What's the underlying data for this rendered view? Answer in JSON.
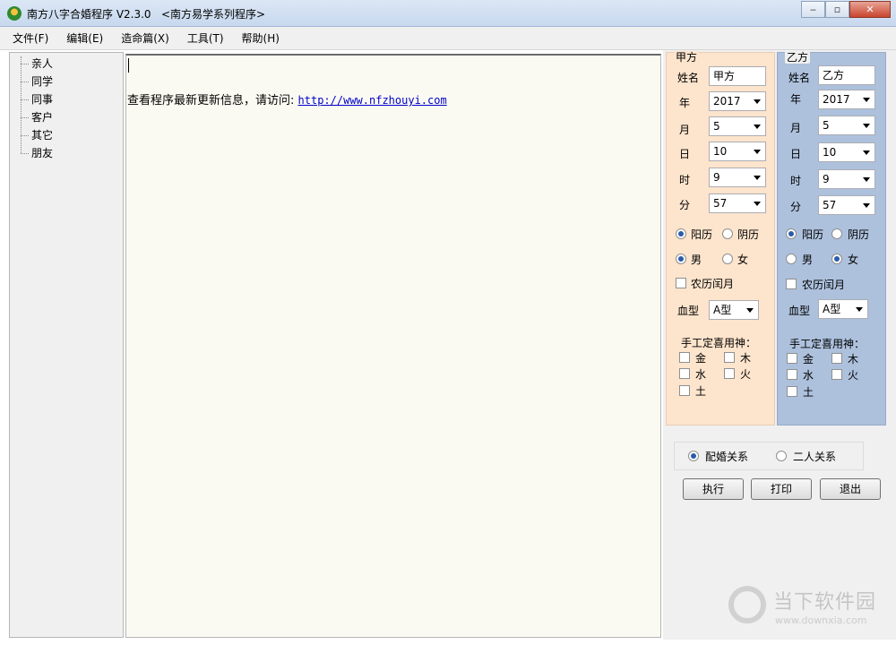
{
  "window": {
    "title": "南方八字合婚程序 V2.3.0   <南方易学系列程序>",
    "minimize": "▭",
    "restore": "□",
    "close": "✕"
  },
  "menu": [
    "文件(F)",
    "编辑(E)",
    "造命篇(X)",
    "工具(T)",
    "帮助(H)"
  ],
  "tree": [
    "亲人",
    "同学",
    "同事",
    "客户",
    "其它",
    "朋友"
  ],
  "content": {
    "info_text": "查看程序最新更新信息，请访问:",
    "link": "http://www.nfzhouyi.com"
  },
  "labels": {
    "name": "姓名",
    "year": "年",
    "month": "月",
    "day": "日",
    "hour": "时",
    "minute": "分",
    "solar": "阳历",
    "lunar": "阴历",
    "male": "男",
    "female": "女",
    "leap": "农历闰月",
    "blood": "血型",
    "manual": "手工定喜用神：",
    "metal": "金",
    "wood": "木",
    "water": "水",
    "fire": "火",
    "earth": "土"
  },
  "party_a": {
    "legend": "甲方",
    "name": "甲方",
    "year": "2017",
    "month": "5",
    "day": "10",
    "hour": "9",
    "minute": "57",
    "calendar": "solar",
    "gender": "male",
    "blood": "A型",
    "color": "#fde4cc"
  },
  "party_b": {
    "legend": "乙方",
    "name": "乙方",
    "year": "2017",
    "month": "5",
    "day": "10",
    "hour": "9",
    "minute": "57",
    "calendar": "solar",
    "gender": "female",
    "blood": "A型",
    "color": "#adc1dd"
  },
  "relation": {
    "opt1": "配婚关系",
    "opt2": "二人关系",
    "selected": "opt1"
  },
  "buttons": {
    "run": "执行",
    "print": "打印",
    "exit": "退出"
  },
  "watermark": {
    "text": "当下软件园",
    "url": "www.downxia.com"
  }
}
